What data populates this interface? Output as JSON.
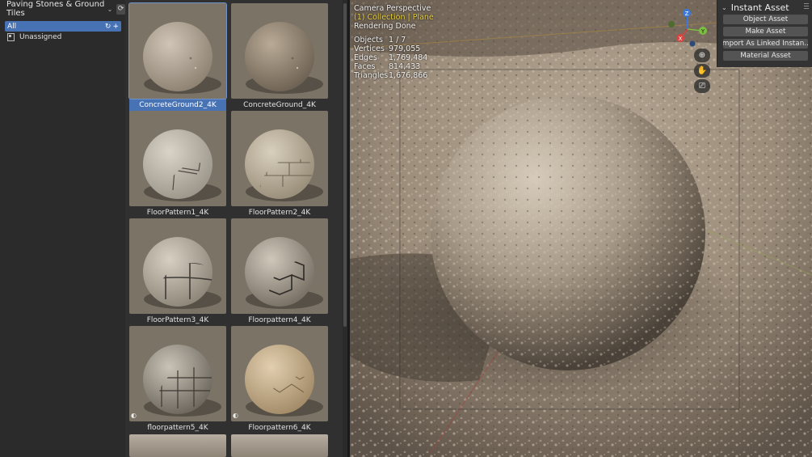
{
  "catalog": {
    "library_name": "Paving Stones & Ground Tiles",
    "categories": [
      {
        "label": "All",
        "active": true
      },
      {
        "label": "Unassigned",
        "active": false
      }
    ]
  },
  "assets": [
    {
      "name": "ConcreteGround2_4K",
      "selected": true,
      "pattern": "pebble-light",
      "badge": false
    },
    {
      "name": "ConcreteGround_4K",
      "selected": false,
      "pattern": "pebble-dark",
      "badge": false
    },
    {
      "name": "FloorPattern1_4K",
      "selected": false,
      "pattern": "flagstone",
      "badge": false
    },
    {
      "name": "FloorPattern2_4K",
      "selected": false,
      "pattern": "brick",
      "badge": false
    },
    {
      "name": "FloorPattern3_4K",
      "selected": false,
      "pattern": "tile",
      "badge": false
    },
    {
      "name": "Floorpattern4_4K",
      "selected": false,
      "pattern": "hex",
      "badge": false
    },
    {
      "name": "floorpattern5_4K",
      "selected": false,
      "pattern": "grid",
      "badge": true
    },
    {
      "name": "Floorpattern6_4K",
      "selected": false,
      "pattern": "herringbone",
      "badge": true
    }
  ],
  "viewport": {
    "camera": "Camera Perspective",
    "collection": "(1) Collection | Plane",
    "status": "Rendering Done",
    "stats": [
      {
        "label": "Objects",
        "value": "1 / 7"
      },
      {
        "label": "Vertices",
        "value": "979,055"
      },
      {
        "label": "Edges",
        "value": "1,769,484"
      },
      {
        "label": "Faces",
        "value": "814,433"
      },
      {
        "label": "Triangles",
        "value": "1,676,866"
      }
    ],
    "gizmo": {
      "x": "X",
      "y": "Y",
      "z": "Z"
    }
  },
  "instant_asset": {
    "title": "Instant Asset",
    "buttons": [
      "Object Asset",
      "Make Asset",
      "Import As Linked Instan...",
      "Material Asset"
    ]
  },
  "colors": {
    "accent": "#4772b3",
    "highlight_text": "#e8d23b",
    "axis_x": "#d9443f",
    "axis_y": "#7cbf3f",
    "axis_z": "#3b78d8"
  }
}
